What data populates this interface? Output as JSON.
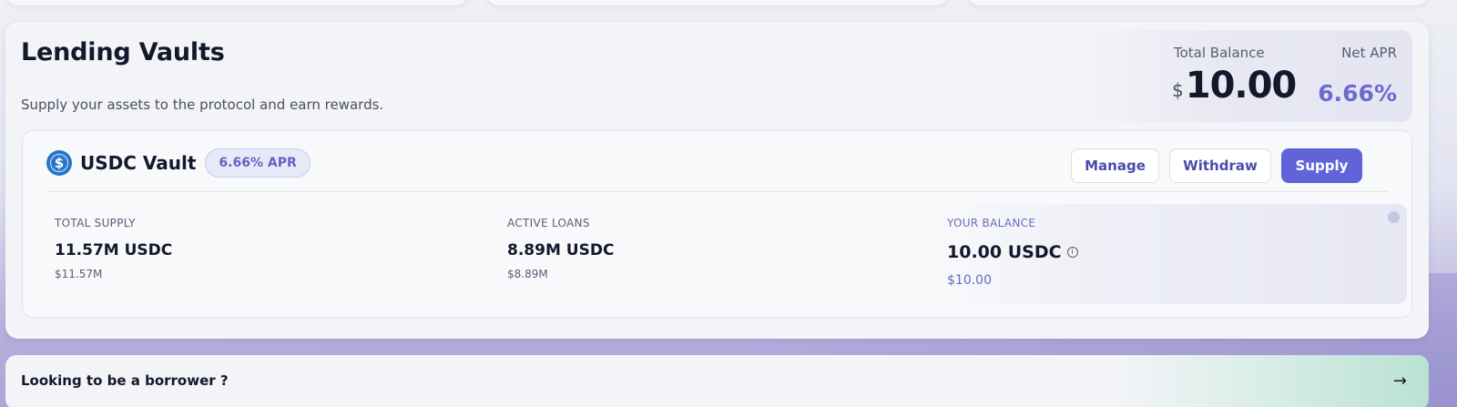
{
  "vaults_section": {
    "title": "Lending Vaults",
    "subtitle": "Supply your assets to the protocol and earn rewards.",
    "total_balance_label": "Total Balance",
    "total_balance_currency": "$",
    "total_balance_value": "10.00",
    "net_apr_label": "Net APR",
    "net_apr_value": "6.66%"
  },
  "vault": {
    "icon": "usdc-coin-icon",
    "icon_glyph": "$",
    "name": "USDC Vault",
    "apr_badge": "6.66% APR",
    "buttons": {
      "manage": "Manage",
      "withdraw": "Withdraw",
      "supply": "Supply"
    },
    "stats": [
      {
        "label": "TOTAL SUPPLY",
        "value": "11.57M USDC",
        "sub": "$11.57M"
      },
      {
        "label": "ACTIVE LOANS",
        "value": "8.89M USDC",
        "sub": "$8.89M"
      },
      {
        "label": "YOUR BALANCE",
        "value": "10.00 USDC",
        "sub": "$10.00"
      }
    ],
    "info_glyph": "i"
  },
  "borrower_banner": {
    "text": "Looking to be a borrower ?",
    "arrow_glyph": "→"
  },
  "colors": {
    "accent": "#6064d8",
    "apr": "#6b6bd0",
    "usdc_blue": "#2775ca"
  }
}
